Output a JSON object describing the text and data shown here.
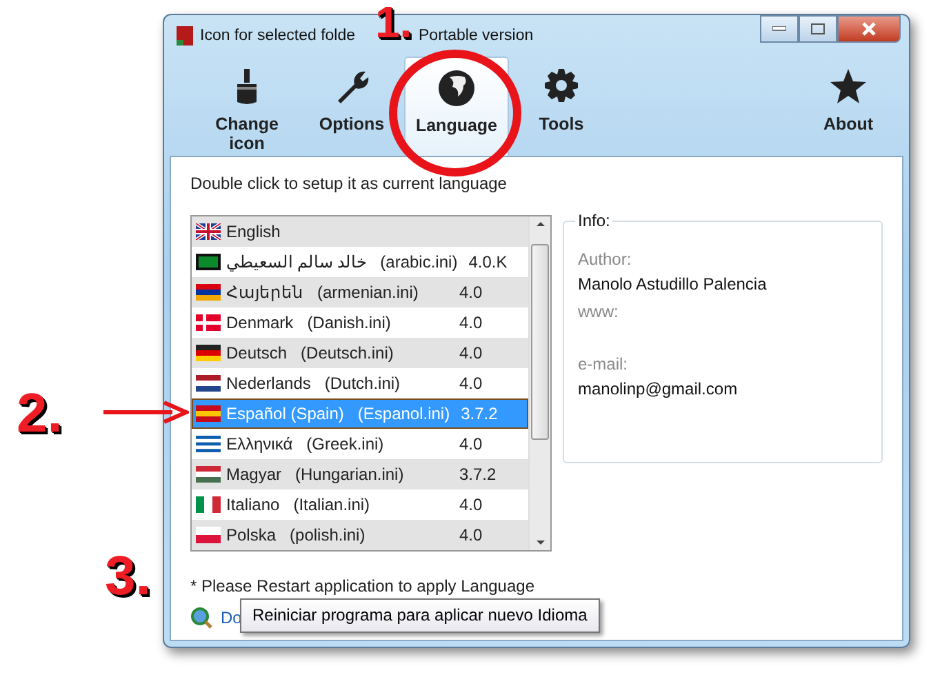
{
  "window": {
    "title_parts": [
      "Icon for selected folde",
      "Portable version"
    ]
  },
  "toolbar": [
    {
      "label": "Change icon",
      "selected": false
    },
    {
      "label": "Options",
      "selected": false
    },
    {
      "label": "Language",
      "selected": true
    },
    {
      "label": "Tools",
      "selected": false
    },
    {
      "label": "About",
      "selected": false
    }
  ],
  "hint": "Double click to setup it as current language",
  "languages": [
    {
      "name": "English",
      "selected": false
    },
    {
      "name": "خالد سالم السعيطي",
      "file": "(arabic.ini)",
      "version": "4.0.K",
      "selected": false
    },
    {
      "name": "Հայերեն",
      "file": "(armenian.ini)",
      "version": "4.0",
      "selected": false
    },
    {
      "name": "Denmark",
      "file": "(Danish.ini)",
      "version": "4.0",
      "selected": false
    },
    {
      "name": "Deutsch",
      "file": "(Deutsch.ini)",
      "version": "4.0",
      "selected": false
    },
    {
      "name": "Nederlands",
      "file": "(Dutch.ini)",
      "version": "4.0",
      "selected": false
    },
    {
      "name": "Español (Spain)",
      "file": "(Espanol.ini)",
      "version": "3.7.2",
      "selected": true
    },
    {
      "name": "Ελληνικά",
      "file": "(Greek.ini)",
      "version": "4.0",
      "selected": false
    },
    {
      "name": "Magyar",
      "file": "(Hungarian.ini)",
      "version": "3.7.2",
      "selected": false
    },
    {
      "name": "Italiano",
      "file": "(Italian.ini)",
      "version": "4.0",
      "selected": false
    },
    {
      "name": "Polska",
      "file": "(polish.ini)",
      "version": "4.0",
      "selected": false
    }
  ],
  "info": {
    "title": "Info:",
    "fields": [
      {
        "label": "Author:",
        "value": "Manolo Astudillo Palencia"
      },
      {
        "label": "www:"
      },
      {
        "label": "e-mail:",
        "value": "manolinp@gmail.com"
      }
    ]
  },
  "note": "* Please Restart application to apply Language",
  "link": "Do",
  "tooltip": "Reiniciar programa para aplicar nuevo Idioma",
  "annotations": [
    "1.",
    "2.",
    "3."
  ]
}
